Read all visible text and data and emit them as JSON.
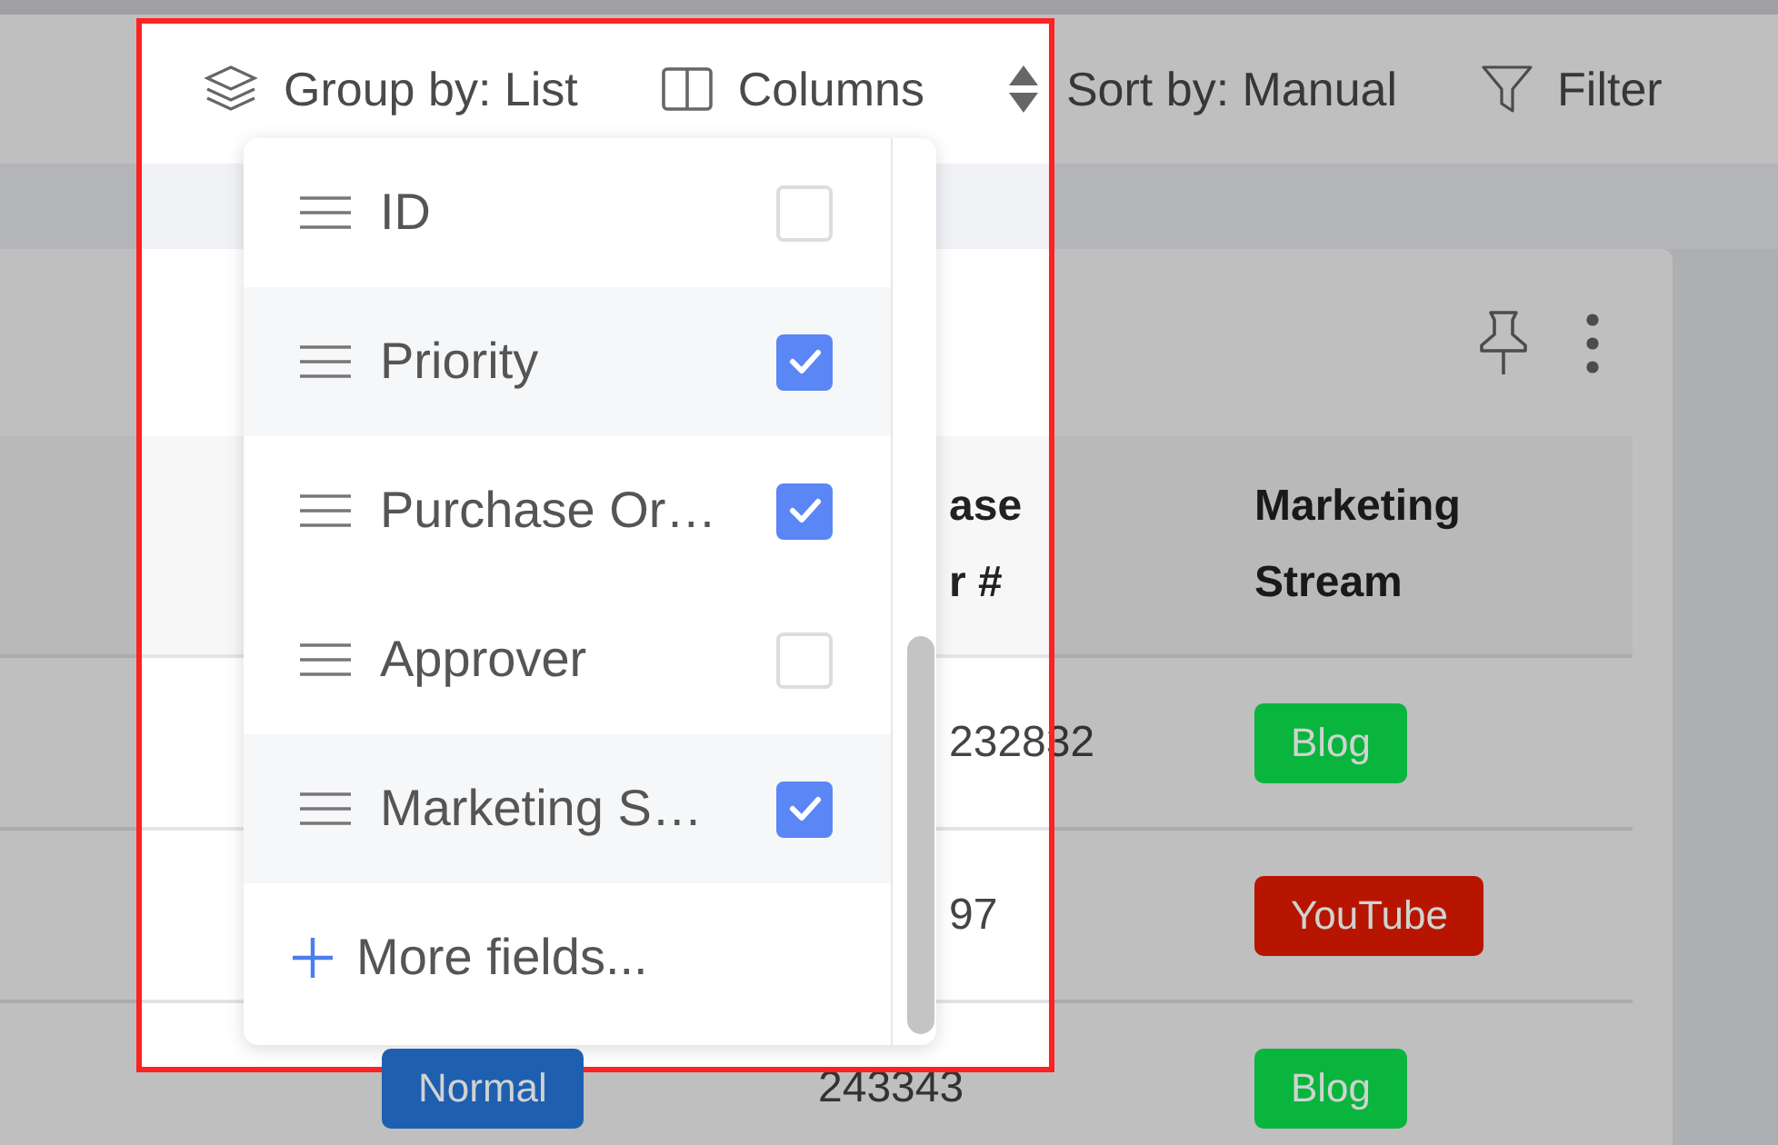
{
  "toolbar": [
    {
      "kind": "group",
      "label": "Group by: List"
    },
    {
      "kind": "columns",
      "label": "Columns"
    },
    {
      "kind": "sort",
      "label": "Sort by: Manual"
    },
    {
      "kind": "filter",
      "label": "Filter"
    }
  ],
  "columns_menu": {
    "items": [
      {
        "label": "ID",
        "checked": false
      },
      {
        "label": "Priority",
        "checked": true
      },
      {
        "label": "Purchase Or…",
        "checked": true
      },
      {
        "label": "Approver",
        "checked": false
      },
      {
        "label": "Marketing S…",
        "checked": true
      }
    ],
    "more_label": "More fields..."
  },
  "table": {
    "columns": [
      "ase r #",
      "Marketing Stream"
    ],
    "rows": [
      {
        "number": "232832",
        "stream": {
          "label": "Blog",
          "color": "#0ab53d"
        }
      },
      {
        "number": "97",
        "stream": {
          "label": "YouTube",
          "color": "#b81500"
        }
      },
      {
        "badge": {
          "label": "Normal",
          "color": "#1f5fb0"
        },
        "number": "243343",
        "stream": {
          "label": "Blog",
          "color": "#0ab53d"
        }
      }
    ]
  }
}
